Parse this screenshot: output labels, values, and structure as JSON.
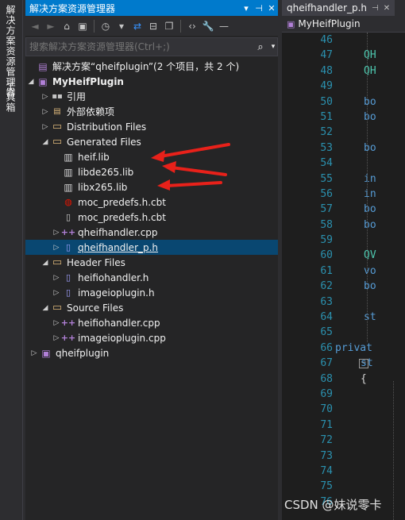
{
  "vertical_tabs": [
    "解决方案资源管理器",
    "工具箱"
  ],
  "panel": {
    "title": "解决方案资源管理器",
    "title_buttons": [
      "▾",
      "⊣",
      "✕"
    ],
    "search_placeholder": "搜索解决方案资源管理器(Ctrl+;)"
  },
  "tree": [
    {
      "label": "解决方案“qheifplugin”(2 个项目，共 2 个)",
      "icon": "sol"
    },
    {
      "label": "MyHeifPlugin",
      "icon": "proj",
      "bold": true
    },
    {
      "label": "引用",
      "icon": "ref"
    },
    {
      "label": "外部依赖项",
      "icon": "ref"
    },
    {
      "label": "Distribution Files",
      "icon": "folder"
    },
    {
      "label": "Generated Files",
      "icon": "folder"
    },
    {
      "label": "heif.lib",
      "icon": "lib"
    },
    {
      "label": "libde265.lib",
      "icon": "lib"
    },
    {
      "label": "libx265.lib",
      "icon": "lib"
    },
    {
      "label": "moc_predefs.h.cbt",
      "icon": "cbt"
    },
    {
      "label": "moc_predefs.h.cbt",
      "icon": "cbt"
    },
    {
      "label": "qheifhandler.cpp",
      "icon": "cpp"
    },
    {
      "label": "qheifhandler_p.h",
      "icon": "h",
      "selected": true
    },
    {
      "label": "Header Files",
      "icon": "folder"
    },
    {
      "label": "heifiohandler.h",
      "icon": "h"
    },
    {
      "label": "imageioplugin.h",
      "icon": "h"
    },
    {
      "label": "Source Files",
      "icon": "folder"
    },
    {
      "label": "heifiohandler.cpp",
      "icon": "cpp"
    },
    {
      "label": "imageioplugin.cpp",
      "icon": "cpp"
    },
    {
      "label": "qheifplugin",
      "icon": "proj"
    }
  ],
  "editor": {
    "tab_label": "qheifhandler_p.h",
    "tab_icons": [
      "⊣",
      "✕"
    ],
    "nav_label": "MyHeifPlugin",
    "line_numbers": [
      "46",
      "47",
      "48",
      "49",
      "50",
      "51",
      "52",
      "53",
      "54",
      "55",
      "56",
      "57",
      "58",
      "59",
      "60",
      "61",
      "62",
      "63",
      "64",
      "65",
      "66",
      "67",
      "68",
      "69",
      "70",
      "71",
      "72",
      "73",
      "74",
      "75",
      "76"
    ],
    "code_lines": [
      {
        "t": "",
        "c": "#d4d4d4"
      },
      {
        "t": "QH",
        "c": "#4ec9b0"
      },
      {
        "t": "QH",
        "c": "#4ec9b0"
      },
      {
        "t": "",
        "c": "#d4d4d4"
      },
      {
        "t": "bo",
        "c": "#569cd6"
      },
      {
        "t": "bo",
        "c": "#569cd6"
      },
      {
        "t": "",
        "c": "#d4d4d4"
      },
      {
        "t": "bo",
        "c": "#569cd6"
      },
      {
        "t": "",
        "c": "#d4d4d4"
      },
      {
        "t": "in",
        "c": "#569cd6"
      },
      {
        "t": "in",
        "c": "#569cd6"
      },
      {
        "t": "bo",
        "c": "#569cd6"
      },
      {
        "t": "bo",
        "c": "#569cd6"
      },
      {
        "t": "",
        "c": "#d4d4d4"
      },
      {
        "t": "QV",
        "c": "#4ec9b0"
      },
      {
        "t": "vo",
        "c": "#569cd6"
      },
      {
        "t": "bo",
        "c": "#569cd6"
      },
      {
        "t": "",
        "c": "#d4d4d4"
      },
      {
        "t": "st",
        "c": "#569cd6"
      },
      {
        "t": "",
        "c": "#d4d4d4"
      },
      {
        "t": "privat",
        "c": "#569cd6"
      },
      {
        "t": "st",
        "c": "#569cd6"
      },
      {
        "t": "{",
        "c": "#d4d4d4"
      }
    ]
  },
  "watermark": "CSDN @妹说零卡"
}
